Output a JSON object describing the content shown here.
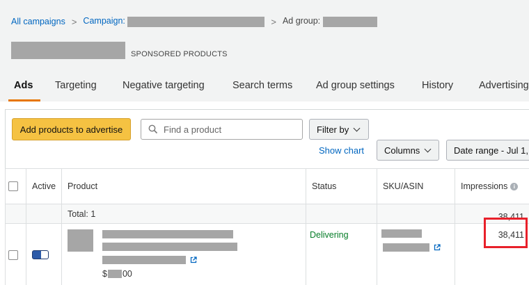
{
  "breadcrumb": {
    "all_campaigns": "All campaigns",
    "campaign_label": "Campaign:",
    "ad_group_label": "Ad group:",
    "separator": ">"
  },
  "header": {
    "subtitle": "SPONSORED PRODUCTS"
  },
  "tabs": [
    {
      "label": "Ads",
      "active": true
    },
    {
      "label": "Targeting"
    },
    {
      "label": "Negative targeting"
    },
    {
      "label": "Search terms"
    },
    {
      "label": "Ad group settings"
    },
    {
      "label": "History"
    },
    {
      "label": "Advertising"
    }
  ],
  "toolbar": {
    "add_products_label": "Add products to advertise",
    "search_placeholder": "Find a product",
    "filter_label": "Filter by",
    "show_chart_label": "Show chart",
    "columns_label": "Columns",
    "date_range_label": "Date range - Jul 1,"
  },
  "table": {
    "columns": [
      "Active",
      "Product",
      "Status",
      "SKU/ASIN",
      "Impressions"
    ],
    "total_label": "Total: 1",
    "total_impressions": "38,411",
    "rows": [
      {
        "status": "Delivering",
        "impressions": "38,411",
        "price_prefix": "$",
        "price_suffix": "00"
      }
    ]
  },
  "colors": {
    "accent": "#e77600",
    "primary_button": "#f5c242",
    "link": "#0066c0",
    "status_delivering": "#067d28",
    "highlight_box": "#e8202a"
  }
}
